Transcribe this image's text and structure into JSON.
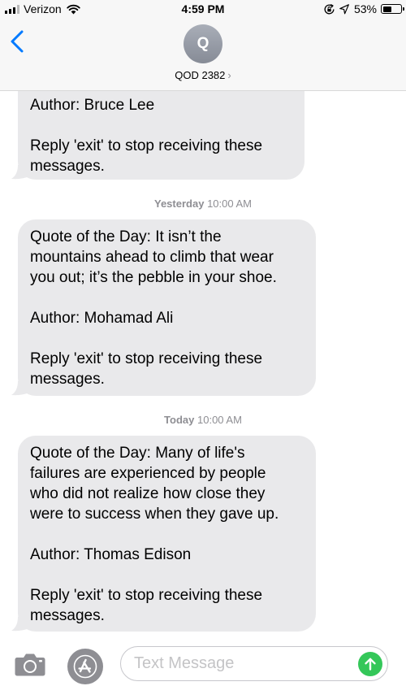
{
  "status_bar": {
    "carrier": "Verizon",
    "time": "4:59 PM",
    "battery_percent": "53%",
    "battery_level": 0.53,
    "signal_bars": 3,
    "icons": [
      "signal-icon",
      "wifi-icon",
      "rotation-lock-icon",
      "location-icon",
      "battery-icon"
    ]
  },
  "header": {
    "avatar_initial": "Q",
    "contact_name": "QOD 2382",
    "chevron": "›",
    "back_icon": "chevron-left-icon"
  },
  "messages": [
    {
      "paragraphs": [
        "Author: Bruce Lee",
        "Reply 'exit' to stop receiving these\nmessages."
      ]
    },
    {
      "timestamp": {
        "day": "Yesterday",
        "time": "10:00 AM"
      },
      "paragraphs": [
        "Quote of the Day: It isn’t the\nmountains ahead to climb that wear\nyou out; it’s the pebble in your shoe.",
        "Author: Mohamad Ali",
        "Reply 'exit' to stop receiving these\nmessages."
      ]
    },
    {
      "timestamp": {
        "day": "Today",
        "time": "10:00 AM"
      },
      "paragraphs": [
        "Quote of the Day: Many of life's\nfailures are experienced by people\nwho did not realize how close they\nwere to success when they gave up.",
        "Author: Thomas Edison",
        "Reply 'exit' to stop receiving these\nmessages."
      ]
    }
  ],
  "input_bar": {
    "placeholder": "Text Message",
    "icons": [
      "camera-icon",
      "appstore-icon",
      "send-arrow-icon"
    ],
    "send_color": "#34c759"
  },
  "colors": {
    "accent": "#007aff",
    "bubble_gray": "#e9e9eb",
    "timestamp_gray": "#8e8e93"
  }
}
